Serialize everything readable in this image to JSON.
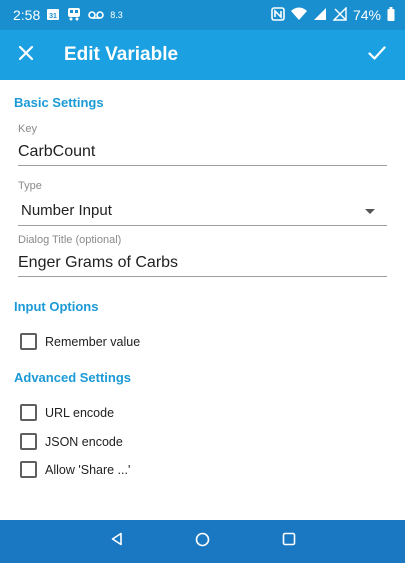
{
  "status_bar": {
    "time": "2:58",
    "calendar_day": "31",
    "small_text": "8.3",
    "battery": "74%"
  },
  "app_bar": {
    "title": "Edit Variable"
  },
  "sections": {
    "basic_settings": "Basic Settings",
    "input_options": "Input Options",
    "advanced_settings": "Advanced Settings"
  },
  "fields": {
    "key": {
      "label": "Key",
      "value": "CarbCount"
    },
    "type": {
      "label": "Type",
      "value": "Number Input"
    },
    "dialog_title": {
      "label": "Dialog Title (optional)",
      "value": "Enger Grams of Carbs"
    }
  },
  "checkboxes": {
    "remember_value": "Remember value",
    "url_encode": "URL encode",
    "json_encode": "JSON encode",
    "allow_share": "Allow 'Share ...'"
  },
  "colors": {
    "status_bar": "#1a8fcf",
    "app_bar": "#1ba1e2",
    "accent": "#1b9ad6",
    "nav_bar": "#1a78c2"
  }
}
